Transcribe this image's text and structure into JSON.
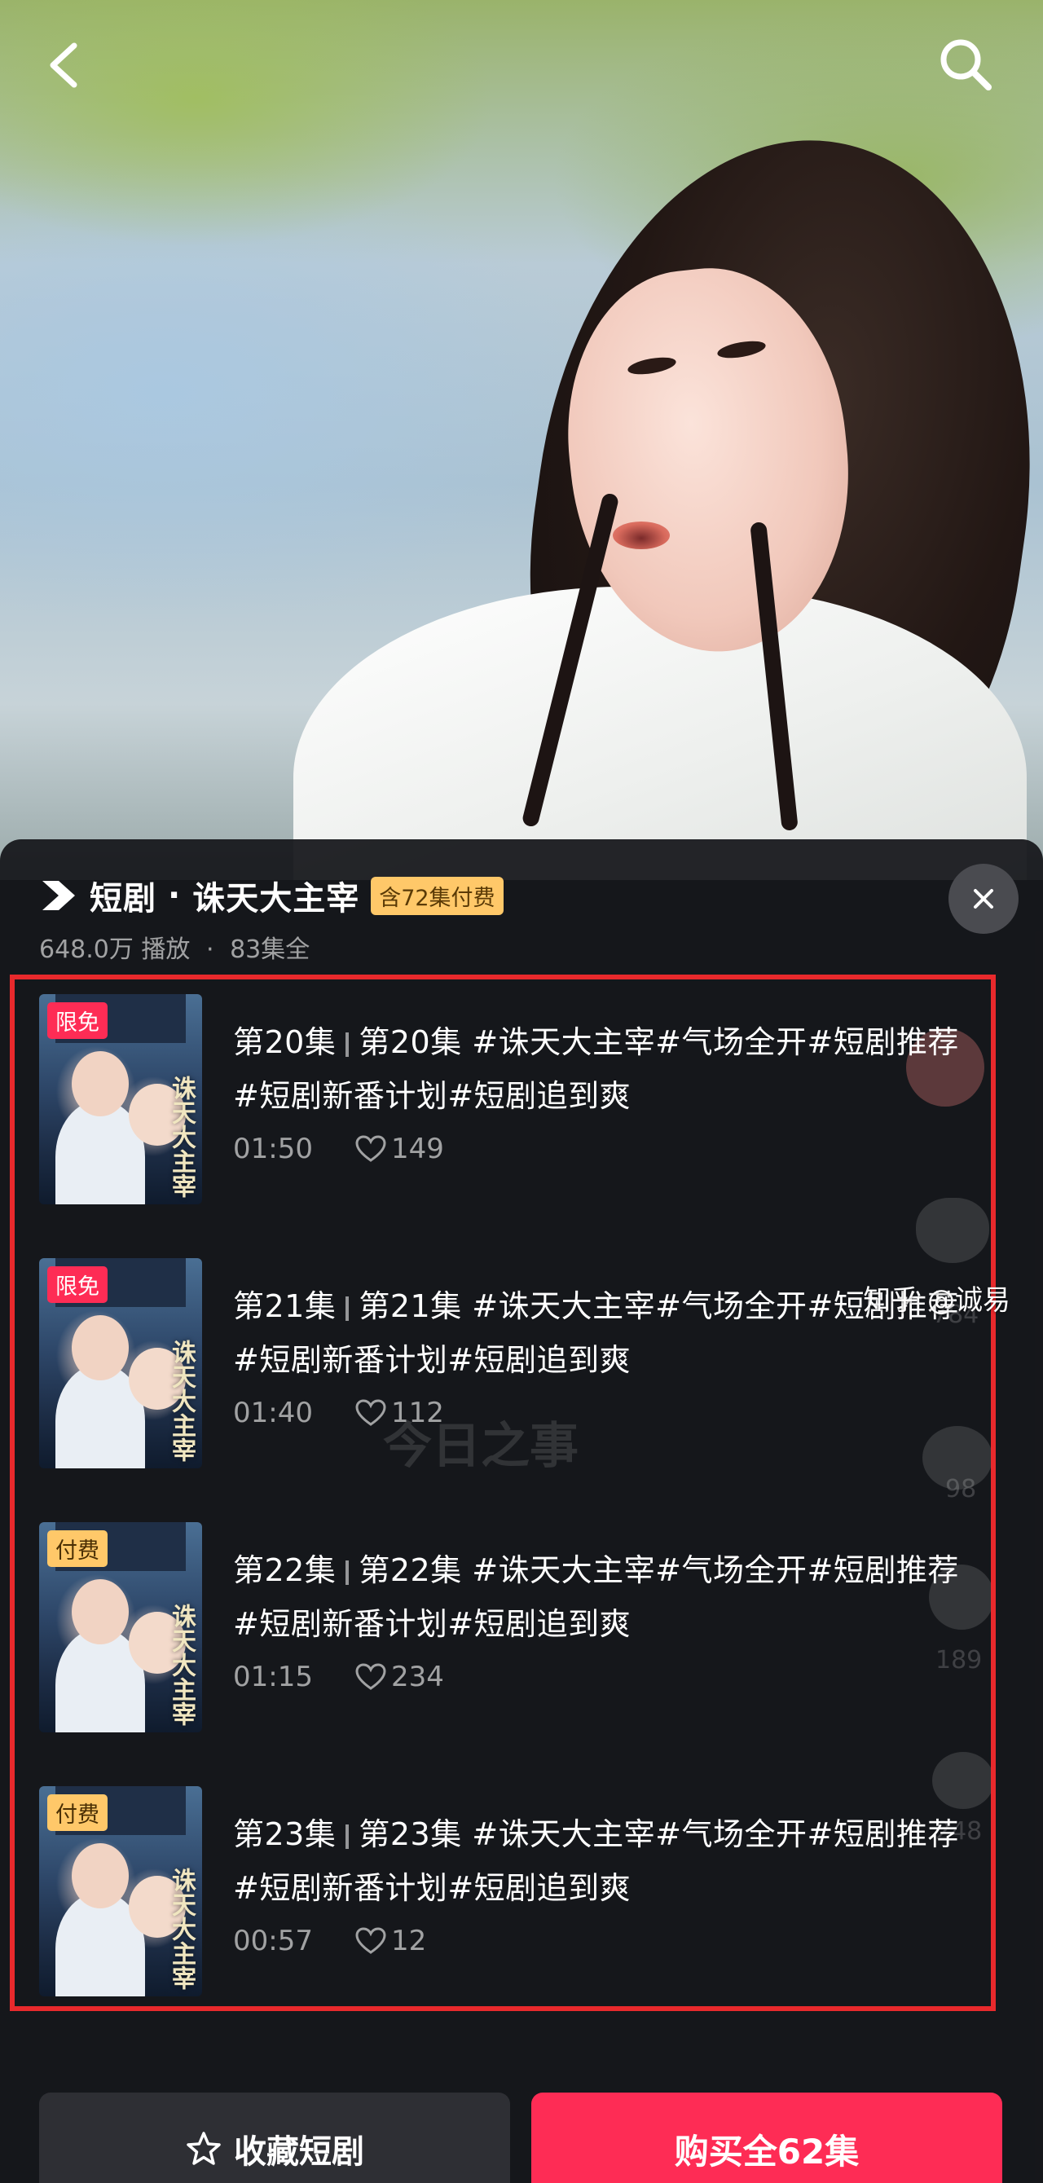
{
  "header": {
    "back_icon": "chevron-left-icon",
    "search_icon": "search-icon"
  },
  "sheet": {
    "brand": "短剧",
    "separator": "·",
    "series_title": "诛天大主宰",
    "paid_badge": "含72集付费",
    "plays": "648.0万 播放",
    "meta_dot": "·",
    "episodes_total": "83集全",
    "close_icon": "close-icon"
  },
  "episodes": [
    {
      "badge": "限免",
      "badge_type": "free",
      "ep_label": "第20集",
      "title": "第20集 #诛天大主宰#气场全开#短剧推荐#短剧新番计划#短剧追到爽",
      "duration": "01:50",
      "likes": "149"
    },
    {
      "badge": "限免",
      "badge_type": "free",
      "ep_label": "第21集",
      "title": "第21集 #诛天大主宰#气场全开#短剧推荐#短剧新番计划#短剧追到爽",
      "duration": "01:40",
      "likes": "112"
    },
    {
      "badge": "付费",
      "badge_type": "pay",
      "ep_label": "第22集",
      "title": "第22集 #诛天大主宰#气场全开#短剧推荐#短剧新番计划#短剧追到爽",
      "duration": "01:15",
      "likes": "234"
    },
    {
      "badge": "付费",
      "badge_type": "pay",
      "ep_label": "第23集",
      "title": "第23集 #诛天大主宰#气场全开#短剧推荐#短剧新番计划#短剧追到爽",
      "duration": "00:57",
      "likes": "12"
    }
  ],
  "thumbnail_calligraphy": "诛天大主宰",
  "background_caption": "今日之事",
  "background_counts": [
    "784",
    "98",
    "189",
    "248"
  ],
  "footer": {
    "favorite_label": "收藏短剧",
    "buy_label": "购买全62集"
  },
  "watermark": "知乎 @诚易",
  "colors": {
    "accent": "#fe2c55",
    "paid_badge": "#ffc869",
    "highlight_frame": "#e8292c",
    "sheet_bg": "#16171c"
  }
}
